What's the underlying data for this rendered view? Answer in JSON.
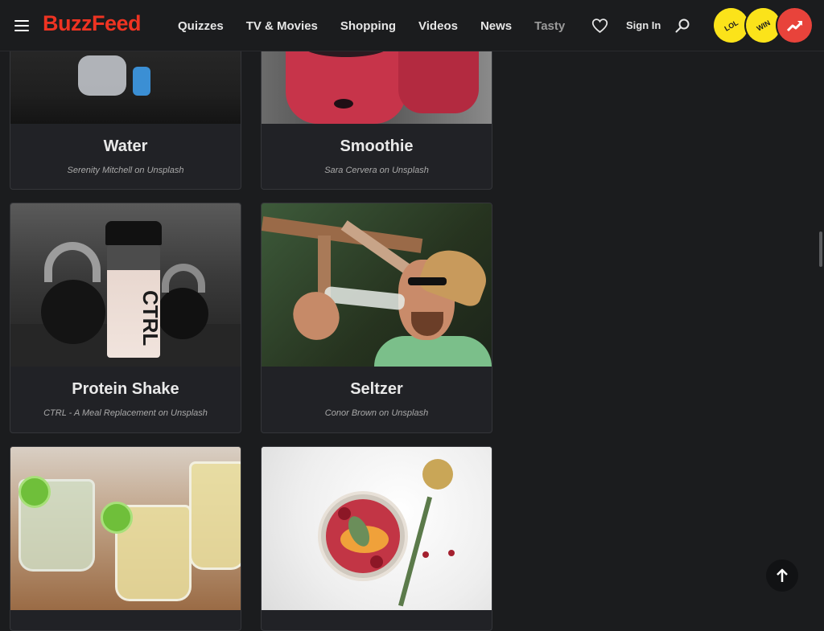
{
  "header": {
    "brand": "BuzzFeed",
    "nav": [
      "Quizzes",
      "TV & Movies",
      "Shopping",
      "Videos",
      "News",
      "Tasty"
    ],
    "sign_in": "Sign In",
    "badges": [
      "LOL",
      "WIN",
      "trending"
    ],
    "colors": {
      "brand": "#ee3322",
      "lol": "#fbe31a",
      "win": "#fbe31a",
      "trending": "#e8433b"
    }
  },
  "cards": [
    {
      "title": "Water",
      "credit": "Serenity Mitchell on Unsplash"
    },
    {
      "title": "Smoothie",
      "credit": "Sara Cervera on Unsplash"
    },
    {
      "title": "Protein Shake",
      "credit": "CTRL - A Meal Replacement on Unsplash"
    },
    {
      "title": "Seltzer",
      "credit": "Conor Brown on Unsplash"
    },
    {
      "title": "",
      "credit": ""
    },
    {
      "title": "",
      "credit": ""
    }
  ],
  "icons": {
    "menu": "hamburger-icon",
    "favorites": "heart-icon",
    "search": "search-icon",
    "back_to_top": "arrow-up-icon"
  }
}
